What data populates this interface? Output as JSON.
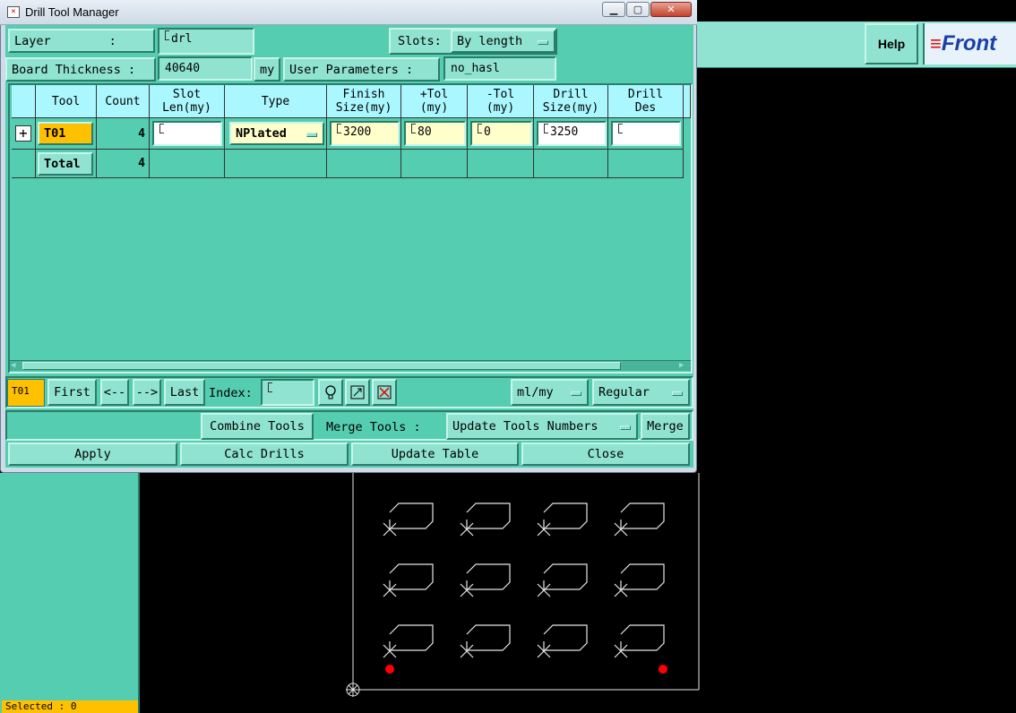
{
  "window": {
    "title": "Drill Tool Manager"
  },
  "background_app": {
    "help_label": "Help",
    "logo_text": "Front",
    "status": "Selected : 0"
  },
  "form": {
    "layer_label": "Layer        :",
    "layer_value": "drl",
    "slots_label": "Slots:",
    "slots_value": "By length",
    "thickness_label": "Board Thickness :",
    "thickness_value": "40640",
    "thickness_unit": "my",
    "user_params_label": "User Parameters :",
    "user_params_value": "no_hasl"
  },
  "table": {
    "headers": [
      "",
      "Tool",
      "Count",
      "Slot\nLen(my)",
      "Type",
      "Finish\nSize(my)",
      "+Tol\n(my)",
      "-Tol\n(my)",
      "Drill\nSize(my)",
      "Drill\nDes"
    ],
    "row": {
      "tool": "T01",
      "count": "4",
      "slot_len": "",
      "type": "NPlated",
      "finish": "3200",
      "plus_tol": "80",
      "minus_tol": "0",
      "drill_size": "3250",
      "drill_des": ""
    },
    "total": {
      "label": "Total",
      "count": "4"
    }
  },
  "nav": {
    "current_tool": "T01",
    "first": "First",
    "prev": "<--",
    "next": "-->",
    "last": "Last",
    "index_label": "Index:",
    "index_value": "",
    "units": "ml/my",
    "mode": "Regular"
  },
  "actions": {
    "combine": "Combine Tools",
    "merge_label": "Merge Tools :",
    "update_numbers": "Update Tools Numbers",
    "merge": "Merge",
    "apply": "Apply",
    "calc": "Calc Drills",
    "update_table": "Update Table",
    "close": "Close"
  },
  "colors": {
    "panel": "#55cdb0",
    "button": "#8fe3d0",
    "header": "#aaf7ff",
    "highlight": "#ffc000",
    "pad": "#ff0000"
  }
}
